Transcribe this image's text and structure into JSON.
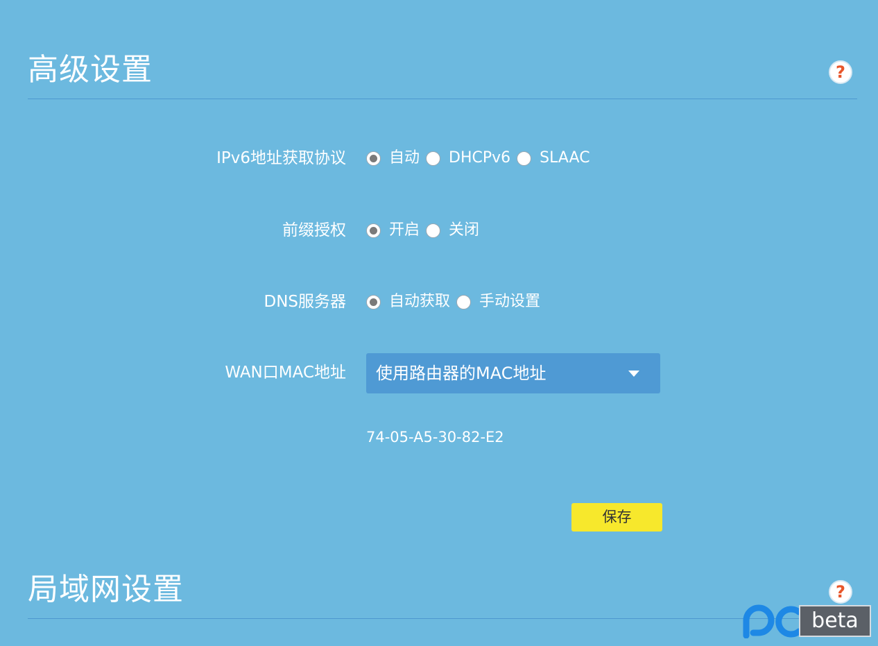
{
  "sections": {
    "advanced": {
      "title": "高级设置",
      "help": "?"
    },
    "lan": {
      "title": "局域网设置",
      "help": "?"
    }
  },
  "form": {
    "ipv6_protocol": {
      "label": "IPv6地址获取协议",
      "options": [
        "自动",
        "DHCPv6",
        "SLAAC"
      ],
      "selected": "自动"
    },
    "prefix_delegation": {
      "label": "前缀授权",
      "options": [
        "开启",
        "关闭"
      ],
      "selected": "开启"
    },
    "dns_server": {
      "label": "DNS服务器",
      "options": [
        "自动获取",
        "手动设置"
      ],
      "selected": "自动获取"
    },
    "wan_mac": {
      "label": "WAN口MAC地址",
      "selected": "使用路由器的MAC地址",
      "value": "74-05-A5-30-82-E2"
    },
    "save_label": "保存"
  },
  "watermark": {
    "brand_text": "beta"
  },
  "colors": {
    "background": "#6cb9df",
    "divider": "#4d97cf",
    "select_bg": "#4f9ad4",
    "save_button": "#f7e82c",
    "help_icon": "#e8562a",
    "watermark_accent": "#1e88e5"
  }
}
